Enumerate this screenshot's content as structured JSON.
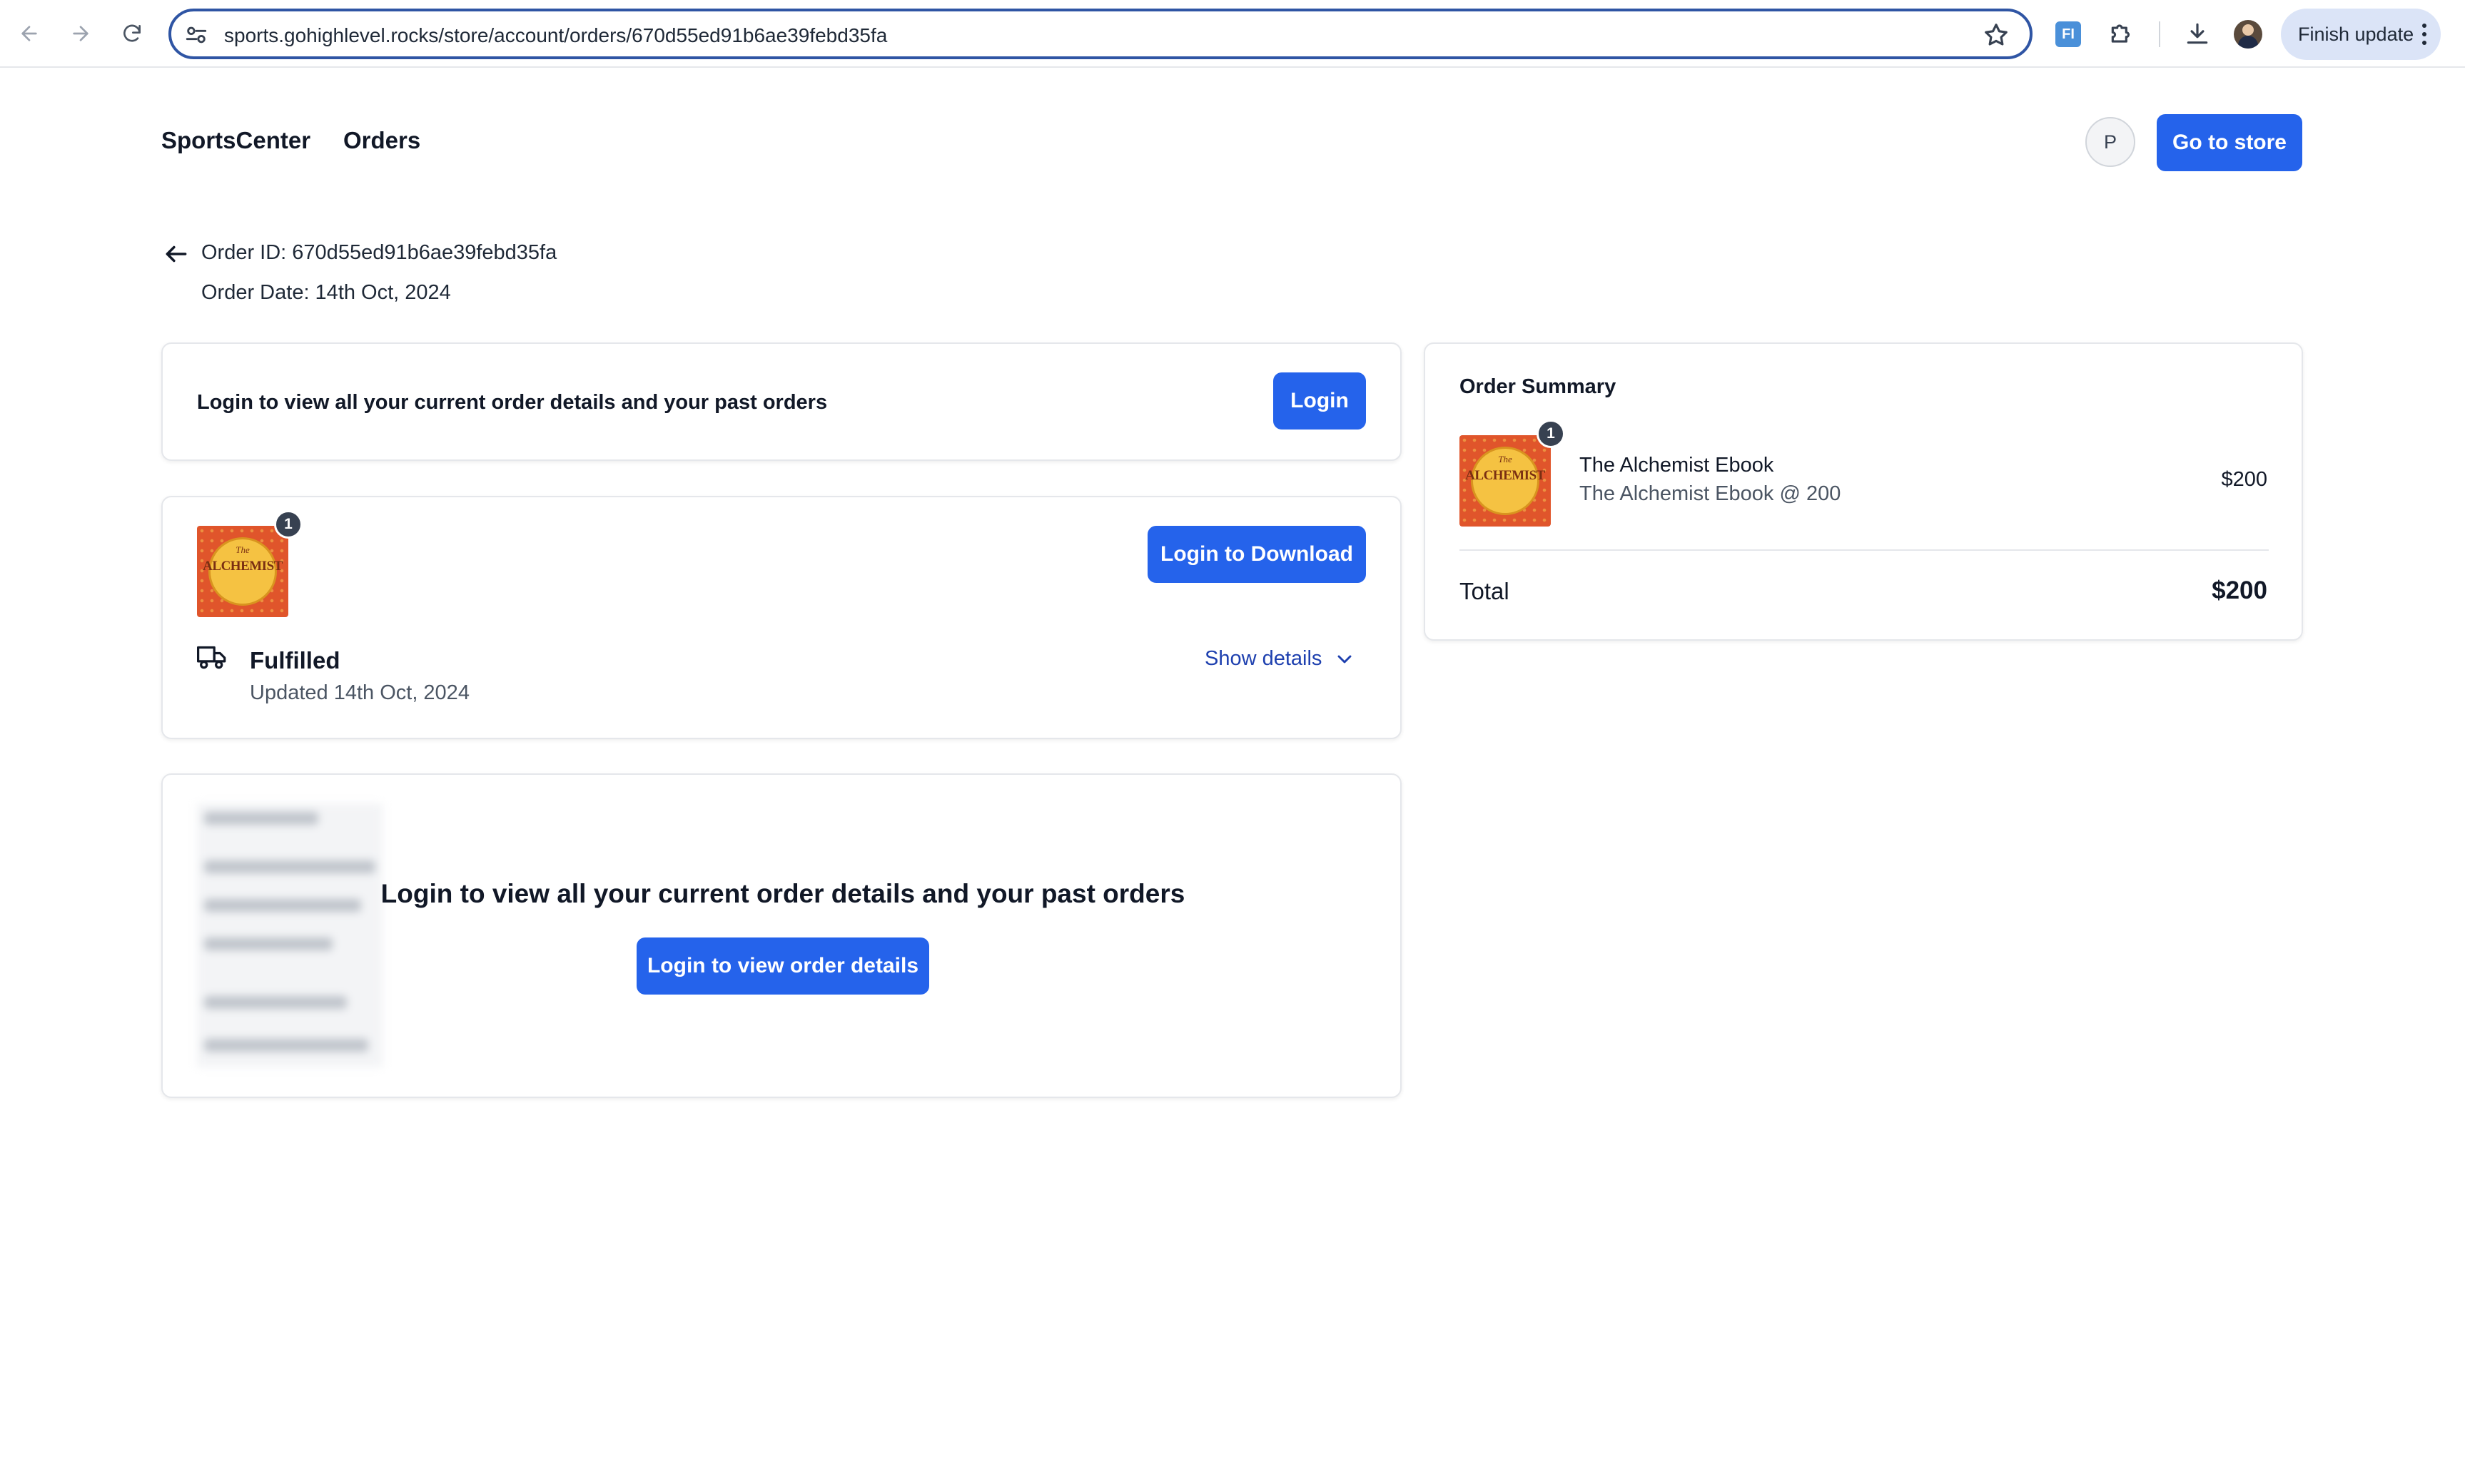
{
  "browser": {
    "url": "sports.gohighlevel.rocks/store/account/orders/670d55ed91b6ae39febd35fa",
    "extension_label": "FI",
    "finish_update_label": "Finish update"
  },
  "header": {
    "brand": "SportsCenter",
    "nav_orders": "Orders",
    "avatar_initial": "P",
    "go_to_store_label": "Go to store"
  },
  "order": {
    "id_text": "Order ID: 670d55ed91b6ae39febd35fa",
    "date_text": "Order Date: 14th Oct, 2024"
  },
  "login_card": {
    "message": "Login to view all your current order details and your past orders",
    "button_label": "Login"
  },
  "item_card": {
    "quantity": "1",
    "download_button_label": "Login to Download",
    "status": "Fulfilled",
    "updated_text": "Updated 14th Oct, 2024",
    "show_details_label": "Show details"
  },
  "blurred_card": {
    "message": "Login to view all your current order details and your past orders",
    "button_label": "Login to view order details"
  },
  "summary": {
    "title": "Order Summary",
    "quantity": "1",
    "product_name": "The Alchemist Ebook",
    "product_variant": "The Alchemist Ebook @ 200",
    "price": "$200",
    "total_label": "Total",
    "total_value": "$200"
  },
  "book_cover": {
    "the": "The",
    "title": "ALCHEMIST"
  },
  "colors": {
    "primary": "#2563eb",
    "link": "#1e40af",
    "omnibox_border": "#2f55a4"
  }
}
